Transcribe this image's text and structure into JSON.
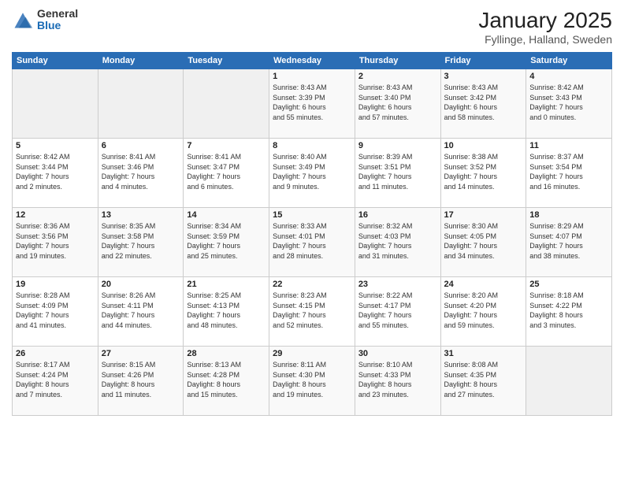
{
  "logo": {
    "general": "General",
    "blue": "Blue"
  },
  "header": {
    "title": "January 2025",
    "subtitle": "Fyllinge, Halland, Sweden"
  },
  "days_of_week": [
    "Sunday",
    "Monday",
    "Tuesday",
    "Wednesday",
    "Thursday",
    "Friday",
    "Saturday"
  ],
  "weeks": [
    [
      {
        "num": "",
        "info": ""
      },
      {
        "num": "",
        "info": ""
      },
      {
        "num": "",
        "info": ""
      },
      {
        "num": "1",
        "info": "Sunrise: 8:43 AM\nSunset: 3:39 PM\nDaylight: 6 hours\nand 55 minutes."
      },
      {
        "num": "2",
        "info": "Sunrise: 8:43 AM\nSunset: 3:40 PM\nDaylight: 6 hours\nand 57 minutes."
      },
      {
        "num": "3",
        "info": "Sunrise: 8:43 AM\nSunset: 3:42 PM\nDaylight: 6 hours\nand 58 minutes."
      },
      {
        "num": "4",
        "info": "Sunrise: 8:42 AM\nSunset: 3:43 PM\nDaylight: 7 hours\nand 0 minutes."
      }
    ],
    [
      {
        "num": "5",
        "info": "Sunrise: 8:42 AM\nSunset: 3:44 PM\nDaylight: 7 hours\nand 2 minutes."
      },
      {
        "num": "6",
        "info": "Sunrise: 8:41 AM\nSunset: 3:46 PM\nDaylight: 7 hours\nand 4 minutes."
      },
      {
        "num": "7",
        "info": "Sunrise: 8:41 AM\nSunset: 3:47 PM\nDaylight: 7 hours\nand 6 minutes."
      },
      {
        "num": "8",
        "info": "Sunrise: 8:40 AM\nSunset: 3:49 PM\nDaylight: 7 hours\nand 9 minutes."
      },
      {
        "num": "9",
        "info": "Sunrise: 8:39 AM\nSunset: 3:51 PM\nDaylight: 7 hours\nand 11 minutes."
      },
      {
        "num": "10",
        "info": "Sunrise: 8:38 AM\nSunset: 3:52 PM\nDaylight: 7 hours\nand 14 minutes."
      },
      {
        "num": "11",
        "info": "Sunrise: 8:37 AM\nSunset: 3:54 PM\nDaylight: 7 hours\nand 16 minutes."
      }
    ],
    [
      {
        "num": "12",
        "info": "Sunrise: 8:36 AM\nSunset: 3:56 PM\nDaylight: 7 hours\nand 19 minutes."
      },
      {
        "num": "13",
        "info": "Sunrise: 8:35 AM\nSunset: 3:58 PM\nDaylight: 7 hours\nand 22 minutes."
      },
      {
        "num": "14",
        "info": "Sunrise: 8:34 AM\nSunset: 3:59 PM\nDaylight: 7 hours\nand 25 minutes."
      },
      {
        "num": "15",
        "info": "Sunrise: 8:33 AM\nSunset: 4:01 PM\nDaylight: 7 hours\nand 28 minutes."
      },
      {
        "num": "16",
        "info": "Sunrise: 8:32 AM\nSunset: 4:03 PM\nDaylight: 7 hours\nand 31 minutes."
      },
      {
        "num": "17",
        "info": "Sunrise: 8:30 AM\nSunset: 4:05 PM\nDaylight: 7 hours\nand 34 minutes."
      },
      {
        "num": "18",
        "info": "Sunrise: 8:29 AM\nSunset: 4:07 PM\nDaylight: 7 hours\nand 38 minutes."
      }
    ],
    [
      {
        "num": "19",
        "info": "Sunrise: 8:28 AM\nSunset: 4:09 PM\nDaylight: 7 hours\nand 41 minutes."
      },
      {
        "num": "20",
        "info": "Sunrise: 8:26 AM\nSunset: 4:11 PM\nDaylight: 7 hours\nand 44 minutes."
      },
      {
        "num": "21",
        "info": "Sunrise: 8:25 AM\nSunset: 4:13 PM\nDaylight: 7 hours\nand 48 minutes."
      },
      {
        "num": "22",
        "info": "Sunrise: 8:23 AM\nSunset: 4:15 PM\nDaylight: 7 hours\nand 52 minutes."
      },
      {
        "num": "23",
        "info": "Sunrise: 8:22 AM\nSunset: 4:17 PM\nDaylight: 7 hours\nand 55 minutes."
      },
      {
        "num": "24",
        "info": "Sunrise: 8:20 AM\nSunset: 4:20 PM\nDaylight: 7 hours\nand 59 minutes."
      },
      {
        "num": "25",
        "info": "Sunrise: 8:18 AM\nSunset: 4:22 PM\nDaylight: 8 hours\nand 3 minutes."
      }
    ],
    [
      {
        "num": "26",
        "info": "Sunrise: 8:17 AM\nSunset: 4:24 PM\nDaylight: 8 hours\nand 7 minutes."
      },
      {
        "num": "27",
        "info": "Sunrise: 8:15 AM\nSunset: 4:26 PM\nDaylight: 8 hours\nand 11 minutes."
      },
      {
        "num": "28",
        "info": "Sunrise: 8:13 AM\nSunset: 4:28 PM\nDaylight: 8 hours\nand 15 minutes."
      },
      {
        "num": "29",
        "info": "Sunrise: 8:11 AM\nSunset: 4:30 PM\nDaylight: 8 hours\nand 19 minutes."
      },
      {
        "num": "30",
        "info": "Sunrise: 8:10 AM\nSunset: 4:33 PM\nDaylight: 8 hours\nand 23 minutes."
      },
      {
        "num": "31",
        "info": "Sunrise: 8:08 AM\nSunset: 4:35 PM\nDaylight: 8 hours\nand 27 minutes."
      },
      {
        "num": "",
        "info": ""
      }
    ]
  ]
}
